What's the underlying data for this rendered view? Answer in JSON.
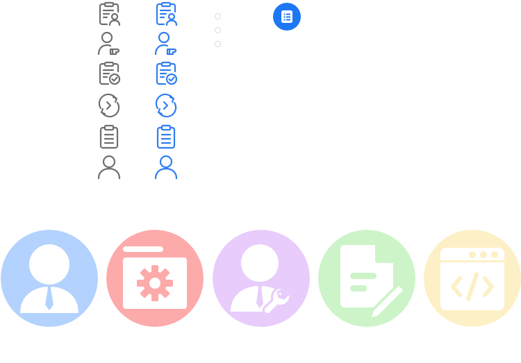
{
  "palette": {
    "icon_gray": "#6e6e6e",
    "icon_blue": "#2f7ef0",
    "badge_blue": "#1e77f3",
    "dot_border": "#d9d9d9",
    "avatar_blue": "#b3d2fd",
    "avatar_red": "#fdaaaa",
    "avatar_purple": "#e8ccfb",
    "avatar_green": "#cdf4c8",
    "avatar_yellow": "#fdf0c6"
  },
  "icon_rows": [
    "clipboard-user-icon",
    "user-pointer-icon",
    "clipboard-check-icon",
    "refresh-arrow-icon",
    "clipboard-list-icon",
    "user-outline-icon"
  ],
  "avatars": [
    "businessman-icon",
    "folder-settings-icon",
    "user-wrench-icon",
    "document-edit-icon",
    "code-window-icon"
  ]
}
